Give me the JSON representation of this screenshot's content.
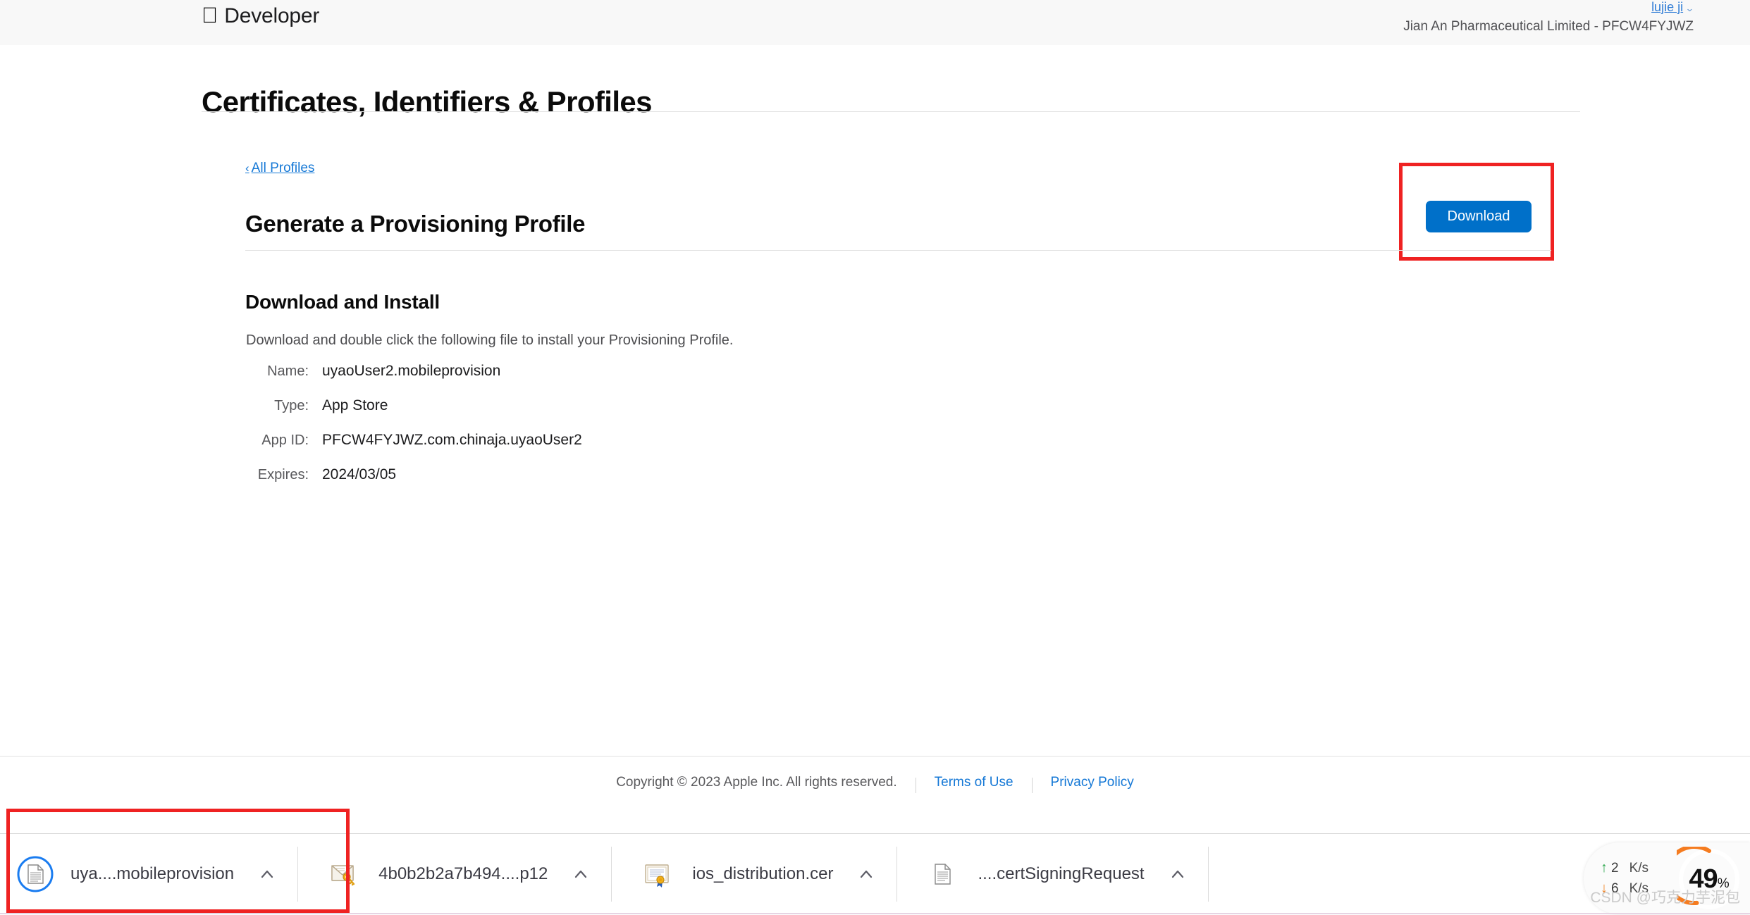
{
  "header": {
    "brand_apple_glyph": "apple-logo-icon",
    "brand_word": "Developer",
    "user_name": "lujie ji",
    "user_chevron": "⌄",
    "team_line": "Jian An Pharmaceutical Limited - PFCW4FYJWZ"
  },
  "page": {
    "title": "Certificates, Identifiers & Profiles",
    "breadcrumb_chevron": "‹",
    "breadcrumb_label": "All Profiles",
    "section_heading": "Generate a Provisioning Profile",
    "download_button_label": "Download",
    "install_heading": "Download and Install",
    "install_description": "Download and double click the following file to install your Provisioning Profile.",
    "details": [
      {
        "label": "Name:",
        "value": "uyaoUser2.mobileprovision"
      },
      {
        "label": "Type:",
        "value": "App Store"
      },
      {
        "label": "App ID:",
        "value": "PFCW4FYJWZ.com.chinaja.uyaoUser2"
      },
      {
        "label": "Expires:",
        "value": "2024/03/05"
      }
    ]
  },
  "footer": {
    "copyright": "Copyright © 2023 Apple Inc. All rights reserved.",
    "terms_label": "Terms of Use",
    "privacy_label": "Privacy Policy"
  },
  "download_bar": {
    "items": [
      {
        "label": "uya....mobileprovision",
        "icon": "document-icon",
        "caret": "⌃"
      },
      {
        "label": "4b0b2b2a7b494....p12",
        "icon": "envelope-key-icon",
        "caret": "⌃"
      },
      {
        "label": "ios_distribution.cer",
        "icon": "certificate-seal-icon",
        "caret": "⌃"
      },
      {
        "label": "....certSigningRequest",
        "icon": "document-icon",
        "caret": "⌃"
      }
    ]
  },
  "net_widget": {
    "upload_arrow": "↑",
    "upload_value": "2",
    "upload_unit": "K/s",
    "download_arrow": "↓",
    "download_value": "6",
    "download_unit": "K/s",
    "cpu_percent": "49",
    "cpu_percent_sign": "%",
    "gauge_color": "#f57c20",
    "upload_color": "#2fa84f",
    "download_color": "#f08020"
  },
  "watermark": {
    "text": "CSDN @巧克力芋泥包"
  },
  "colors": {
    "accent_blue": "#0070c9",
    "link_blue": "#1578d6",
    "highlight_red": "#ef2222"
  }
}
